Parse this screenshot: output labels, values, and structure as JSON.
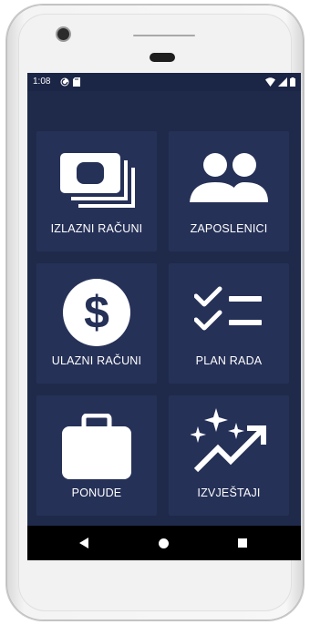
{
  "status_bar": {
    "time": "1:08",
    "left_icons": [
      "sync-icon",
      "sd-card-icon"
    ],
    "right_icons": [
      "wifi-icon",
      "signal-icon",
      "battery-icon"
    ]
  },
  "tiles": [
    {
      "label": "IZLAZNI RAČUNI",
      "icon": "money-icon"
    },
    {
      "label": "ZAPOSLENICI",
      "icon": "people-icon"
    },
    {
      "label": "ULAZNI RAČUNI",
      "icon": "dollar-icon"
    },
    {
      "label": "PLAN RADA",
      "icon": "checklist-icon"
    },
    {
      "label": "PONUDE",
      "icon": "briefcase-icon"
    },
    {
      "label": "IZVJEŠTAJI",
      "icon": "trending-sparkle-icon"
    }
  ],
  "nav_bar": {
    "buttons": [
      "back-icon",
      "home-icon",
      "recents-icon"
    ]
  },
  "colors": {
    "background": "#1f2a4a",
    "tile": "#263158",
    "text": "#ffffff"
  }
}
